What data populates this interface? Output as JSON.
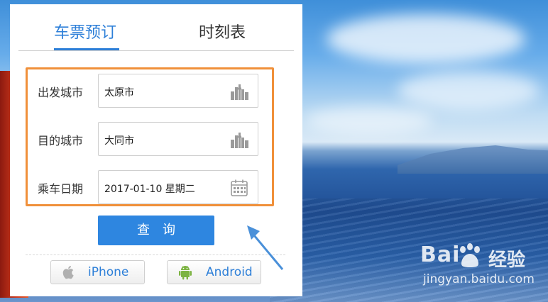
{
  "tabs": [
    {
      "label": "车票预订",
      "active": true
    },
    {
      "label": "时刻表",
      "active": false
    }
  ],
  "form": {
    "departure": {
      "label": "出发城市",
      "value": "太原市",
      "icon": "city-icon"
    },
    "destination": {
      "label": "目的城市",
      "value": "大同市",
      "icon": "city-icon"
    },
    "date": {
      "label": "乘车日期",
      "value": "2017-01-10 星期二",
      "icon": "calendar-icon"
    }
  },
  "query_button": {
    "label": "查询"
  },
  "apps": [
    {
      "label": "iPhone",
      "icon": "apple-icon"
    },
    {
      "label": "Android",
      "icon": "android-icon"
    }
  ],
  "watermark": {
    "logo": "Bai",
    "logo_suffix": "经验",
    "url": "jingyan.baidu.com"
  },
  "colors": {
    "accent": "#2d7fd8",
    "button": "#2e86e0",
    "highlight_box": "#f0903a",
    "android_green": "#7cb342",
    "arrow": "#4a90d9"
  }
}
